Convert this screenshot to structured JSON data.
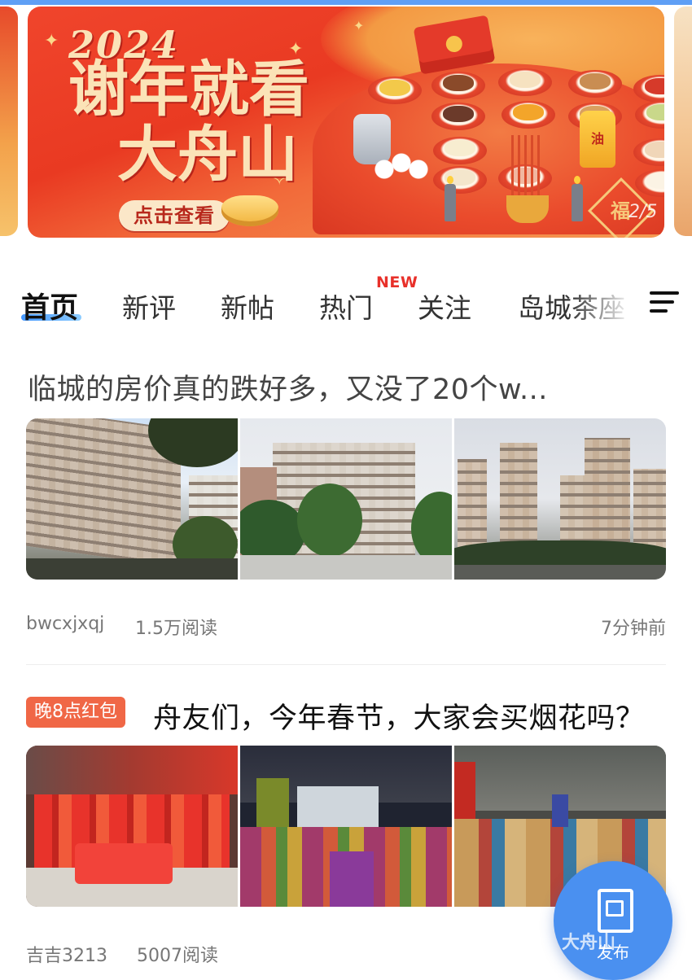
{
  "banner": {
    "year": "2024",
    "headline_line1": "谢年就看",
    "headline_line2": "大舟山",
    "cta_label": "点击查看",
    "bottle_label": "油",
    "fu_char": "福",
    "slide_indicator": "2/5"
  },
  "tabs": [
    {
      "label": "首页",
      "active": true
    },
    {
      "label": "新评",
      "active": false
    },
    {
      "label": "新帖",
      "active": false
    },
    {
      "label": "热门",
      "active": false,
      "badge": "NEW"
    },
    {
      "label": "关注",
      "active": false
    },
    {
      "label": "岛城茶座",
      "active": false
    }
  ],
  "posts": [
    {
      "title": "临城的房价真的跌好多，又没了20个w...",
      "author": "bwcxjxqj",
      "reads": "1.5万阅读",
      "time": "7分钟前",
      "images": [
        "apartment-buildings-photo",
        "residential-block-photo",
        "high-rise-towers-photo"
      ]
    },
    {
      "tag": "晚8点红包",
      "title": "舟友们，今年春节，大家会买烟花吗？",
      "author": "吉吉3213",
      "reads": "5007阅读",
      "images": [
        "fireworks-shop-photo",
        "fireworks-stall-night-photo",
        "fireworks-market-photo"
      ]
    }
  ],
  "fab": {
    "label": "发布"
  },
  "watermark": "大舟山"
}
